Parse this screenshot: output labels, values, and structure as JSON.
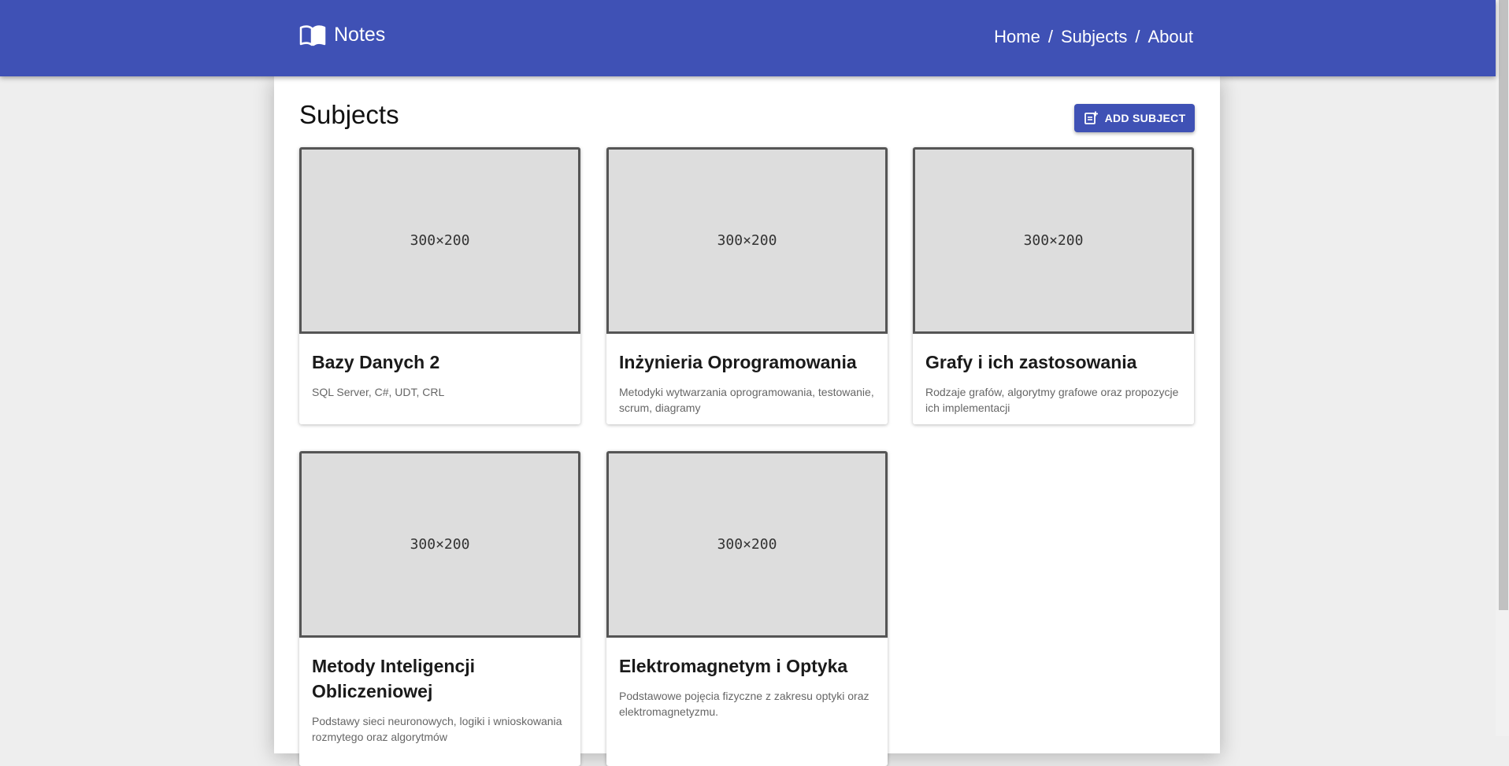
{
  "appbar": {
    "title": "Notes",
    "nav": [
      "Home",
      "Subjects",
      "About"
    ],
    "separator": "/"
  },
  "page": {
    "title": "Subjects",
    "add_button_label": "ADD SUBJECT"
  },
  "cards": [
    {
      "image_label": "300×200",
      "title": "Bazy Danych 2",
      "description": "SQL Server, C#, UDT, CRL"
    },
    {
      "image_label": "300×200",
      "title": "Inżynieria Oprogramowania",
      "description": "Metodyki wytwarzania oprogramowania, testowanie, scrum, diagramy"
    },
    {
      "image_label": "300×200",
      "title": "Grafy i ich zastosowania",
      "description": "Rodzaje grafów, algorytmy grafowe oraz propozycje ich implementacji"
    },
    {
      "image_label": "300×200",
      "title": "Metody Inteligencji Obliczeniowej",
      "description": "Podstawy sieci neuronowych, logiki i wnioskowania rozmytego oraz algorytmów"
    },
    {
      "image_label": "300×200",
      "title": "Elektromagnetym i Optyka",
      "description": "Podstawowe pojęcia fizyczne z zakresu optyki oraz elektromagnetyzmu."
    }
  ],
  "colors": {
    "primary": "#3f51b5",
    "background": "#eeeeee",
    "placeholder": "#dddddd"
  },
  "icons": {
    "brand": "book-open-icon",
    "add": "note-add-icon"
  }
}
